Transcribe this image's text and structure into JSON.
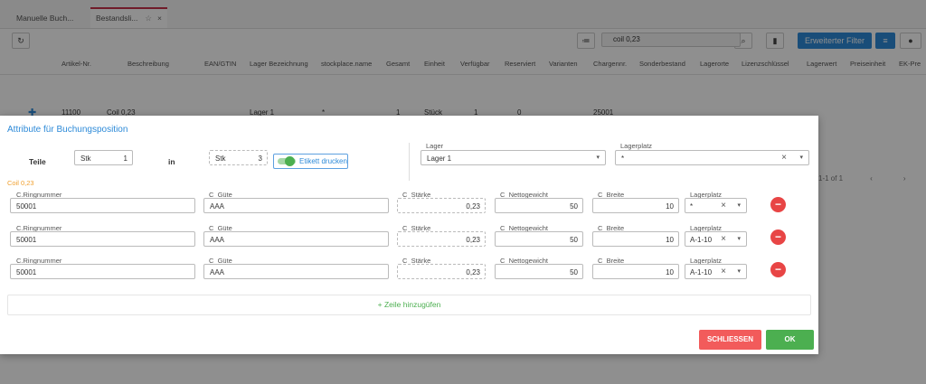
{
  "tabs": [
    {
      "label": "Manuelle Buch..."
    },
    {
      "label": "Bestandsli...",
      "star": "☆",
      "close": "×"
    }
  ],
  "toolbar": {
    "refresh_icon": "↻",
    "sort_icon": "≔",
    "search_value": "coil 0,23",
    "search_icon": "⌕",
    "pdf_icon": "▮",
    "filter_label": "Erweiterter Filter",
    "filter_icon": "≡",
    "toggle_icon": "●"
  },
  "table": {
    "headers": [
      "Artikel-Nr.",
      "Beschreibung",
      "EAN/GTIN",
      "Lager Bezeichnung",
      "stockplace.name",
      "Gesamt",
      "Einheit",
      "Verfügbar",
      "Reserviert",
      "Varianten",
      "Chargennr.",
      "Sonderbestand",
      "Lagerorte",
      "Lizenzschlüssel",
      "Lagerwert",
      "Preiseinheit",
      "EK-Pre"
    ],
    "row": [
      "11100",
      "Coil 0,23",
      "Lager 1",
      "*",
      "1",
      "Stück",
      "1",
      "0",
      "25001"
    ],
    "pager": "1-1 of 1",
    "pager_prev": "‹",
    "pager_next": "›"
  },
  "modal": {
    "title": "Attribute für Buchungsposition",
    "teile_label": "Teile",
    "teile_unit": "Stk",
    "teile_value": "1",
    "in_label": "in",
    "in_unit": "Stk",
    "in_value": "3",
    "etikett_label": "Etikett drucken",
    "lager_label": "Lager",
    "lager_value": "Lager 1",
    "lagerplatz_label": "Lagerplatz",
    "lagerplatz_value": "*",
    "product_name": "Coil 0,23",
    "field_labels": {
      "ring": "C.Ringnummer",
      "guete": "C_Güte",
      "staerke": "C_Stärke",
      "netto": "C_Nettogewicht",
      "breite": "C_Breite",
      "lagerplatz": "Lagerplatz"
    },
    "rows": [
      {
        "ring": "50001",
        "guete": "AAA",
        "staerke": "0,23",
        "netto": "50",
        "breite": "10",
        "lagerplatz": "*"
      },
      {
        "ring": "50001",
        "guete": "AAA",
        "staerke": "0,23",
        "netto": "50",
        "breite": "10",
        "lagerplatz": "A-1-10"
      },
      {
        "ring": "50001",
        "guete": "AAA",
        "staerke": "0,23",
        "netto": "50",
        "breite": "10",
        "lagerplatz": "A-1-10"
      }
    ],
    "add_row_label": "+ Zeile hinzugüfen",
    "close_label": "SCHLIESSEN",
    "ok_label": "OK",
    "caret_icon": "▾",
    "clear_icon": "×",
    "remove_icon": "−"
  },
  "colors": {
    "accent": "#2d8ad8",
    "danger": "#f25b5b",
    "success": "#4caf50",
    "warning": "#f0a030"
  }
}
